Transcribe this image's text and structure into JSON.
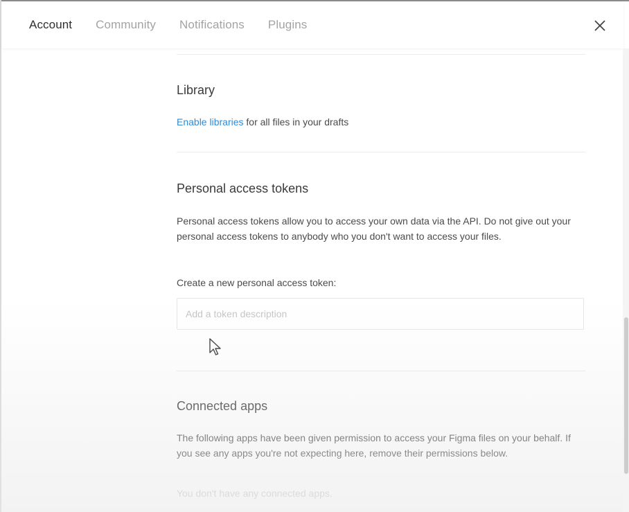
{
  "tabs": [
    {
      "label": "Account",
      "active": true
    },
    {
      "label": "Community",
      "active": false
    },
    {
      "label": "Notifications",
      "active": false
    },
    {
      "label": "Plugins",
      "active": false
    }
  ],
  "close_icon": "close-icon",
  "library": {
    "title": "Library",
    "link_text": "Enable libraries",
    "rest_text": " for all files in your drafts"
  },
  "tokens": {
    "title": "Personal access tokens",
    "description": "Personal access tokens allow you to access your own data via the API. Do not give out your personal access tokens to anybody who you don't want to access your files.",
    "create_label": "Create a new personal access token:",
    "input_placeholder": "Add a token description",
    "input_value": ""
  },
  "connected_apps": {
    "title": "Connected apps",
    "description": "The following apps have been given permission to access your Figma files on your behalf. If you see any apps you're not expecting here, remove their permissions below.",
    "empty_text": "You don't have any connected apps."
  },
  "colors": {
    "link": "#2f8bd6",
    "active_tab": "#2e2e2e",
    "inactive_tab": "#a3a3a3"
  }
}
